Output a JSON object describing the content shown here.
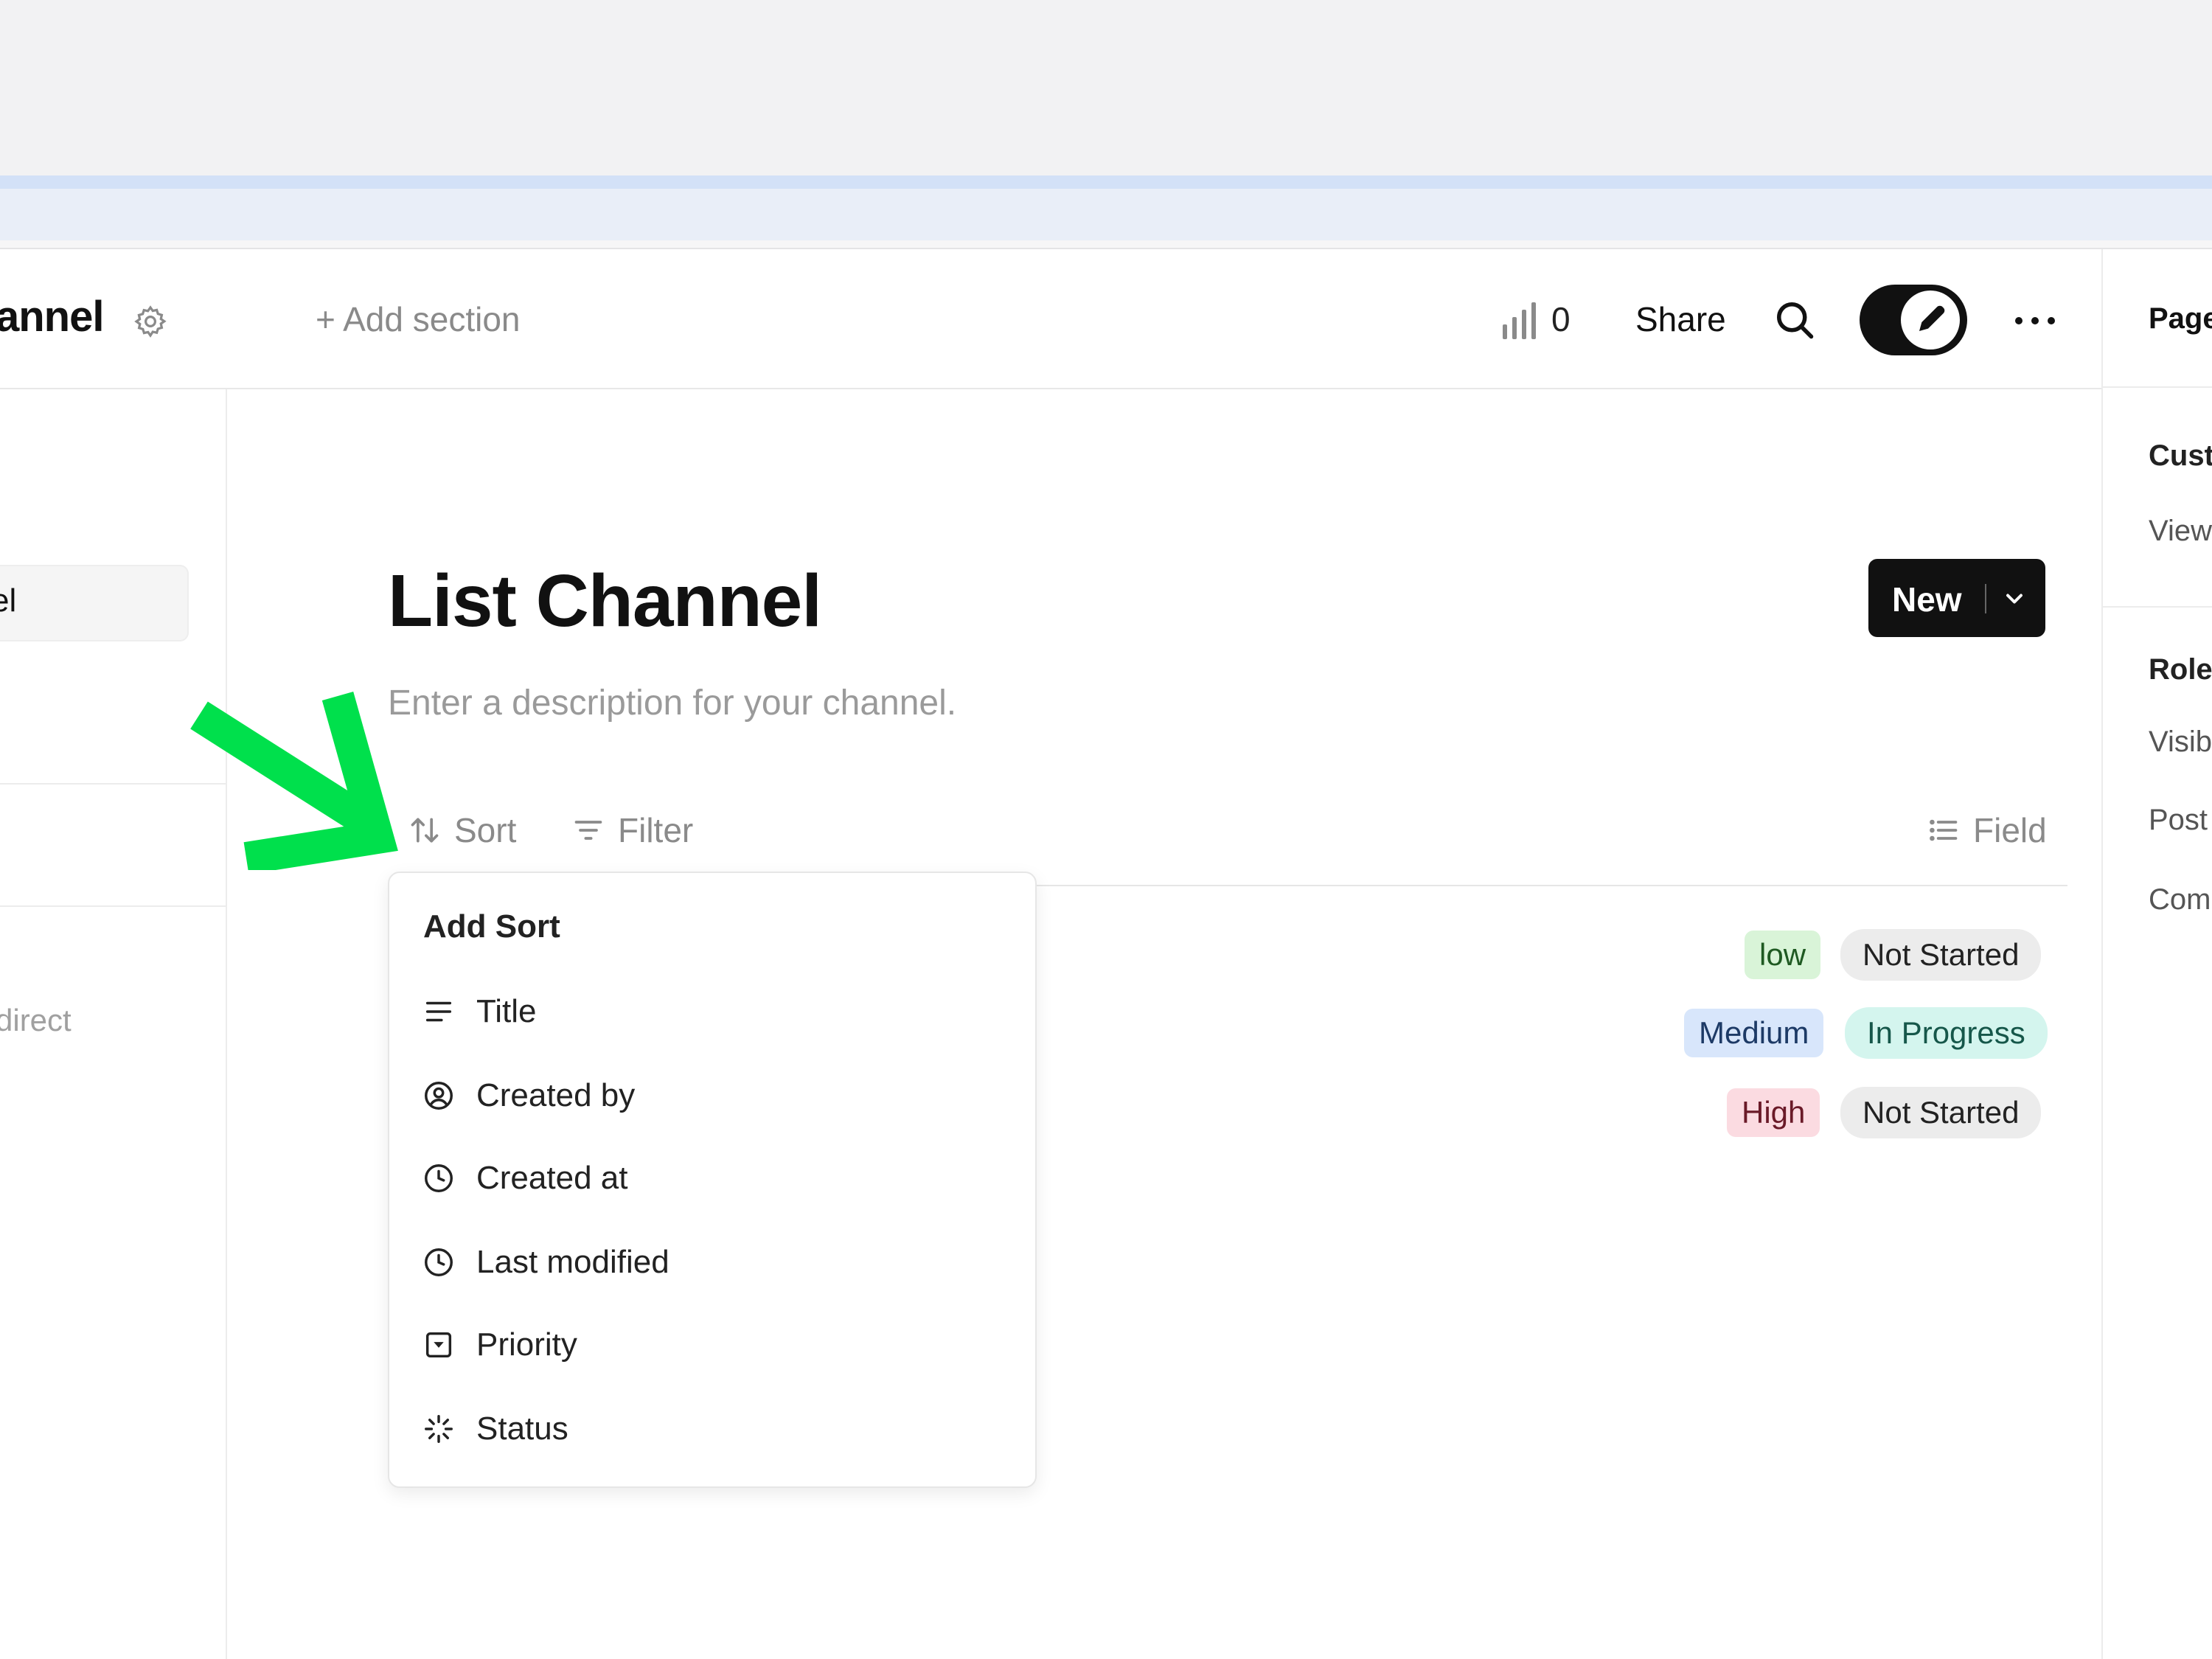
{
  "header": {
    "channel_name": "annel",
    "add_section": "Add section",
    "stats_count": "0",
    "share_label": "Share"
  },
  "sidebar": {
    "active_item": "el",
    "direct_item": "direct"
  },
  "right_panel": {
    "items": [
      "Page",
      "Cust",
      "View",
      "Role",
      "Visib",
      "Post",
      "Com"
    ]
  },
  "main": {
    "title": "List Channel",
    "description_placeholder": "Enter a description for your channel.",
    "new_button": "New",
    "toolbar": {
      "sort": "Sort",
      "filter": "Filter",
      "field": "Field"
    },
    "rows": [
      {
        "priority": "low",
        "status": "Not Started"
      },
      {
        "priority": "Medium",
        "status": "In Progress"
      },
      {
        "priority": "High",
        "status": "Not Started"
      }
    ]
  },
  "sort_menu": {
    "header": "Add Sort",
    "items": [
      {
        "label": "Title",
        "icon": "text-lines-icon"
      },
      {
        "label": "Created by",
        "icon": "user-circle-icon"
      },
      {
        "label": "Created at",
        "icon": "clock-icon"
      },
      {
        "label": "Last modified",
        "icon": "clock-icon"
      },
      {
        "label": "Priority",
        "icon": "select-box-icon"
      },
      {
        "label": "Status",
        "icon": "spinner-icon"
      }
    ]
  },
  "colors": {
    "arrow": "#00e04c",
    "low_bg": "#d9f4d8",
    "medium_bg": "#d8e6fb",
    "high_bg": "#fbdbe1",
    "in_progress_bg": "#d4f5ee",
    "not_started_bg": "#ececec"
  }
}
